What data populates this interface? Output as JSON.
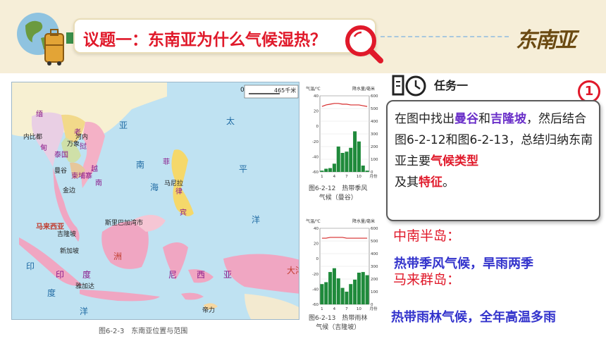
{
  "header": {
    "title": "议题一：东南亚为什么气候湿热？",
    "logo_text": "东南亚"
  },
  "map": {
    "caption": "图6-2-3　东南亚位置与范围",
    "scale": "465千米",
    "scale_zero": "0",
    "countries": {
      "burma": "缅",
      "burma2": "甸",
      "laos": "老",
      "laos2": "挝",
      "thailand": "泰国",
      "vietnam": "越",
      "vietnam2": "南",
      "cambodia": "柬埔寨",
      "philippines": "菲",
      "philippines2": "律",
      "philippines3": "宾",
      "malaysia": "马来西亚",
      "indonesia1": "印",
      "indonesia2": "度",
      "indonesia3": "尼",
      "indonesia4": "西",
      "indonesia5": "亚",
      "brunei": "文莱",
      "eastTimor": "东帝汶"
    },
    "cities": {
      "naypyidaw": "内比都",
      "vientiane": "万象",
      "hanoi": "河内",
      "bangkok": "曼谷",
      "phnompenh": "金边",
      "manila": "马尼拉",
      "kualalumpur": "吉隆坡",
      "singapore": "新加坡",
      "bandar": "斯里巴加湾市",
      "jakarta": "雅加达",
      "dili": "帝力"
    },
    "seas": {
      "asia": "亚",
      "pacific1": "太",
      "pacific2": "平",
      "pacific3": "洋",
      "southsea": "南",
      "sea": "海",
      "indian": "印",
      "indian2": "度",
      "indian3": "洋",
      "zhou": "洲",
      "dayang": "大洋",
      "oceania": "洲"
    }
  },
  "charts": [
    {
      "caption_line1": "图6-2-12　热带季风",
      "caption_line2": "气候（曼谷）",
      "ylabel_left": "气温/℃",
      "ylabel_right": "降水量/毫米",
      "x_ticks": [
        "1",
        "4",
        "7",
        "10",
        "月份"
      ],
      "left_ticks": [
        "40",
        "20",
        "0",
        "-20",
        "-40",
        "-60"
      ],
      "right_ticks": [
        "600",
        "500",
        "400",
        "300",
        "200",
        "100",
        "0"
      ]
    },
    {
      "caption_line1": "图6-2-13　热带雨林",
      "caption_line2": "气候（吉隆坡）",
      "ylabel_left": "气温/℃",
      "ylabel_right": "降水量/毫米",
      "x_ticks": [
        "1",
        "4",
        "7",
        "10",
        "月份"
      ],
      "left_ticks": [
        "40",
        "20",
        "0",
        "-20",
        "-40",
        "-60"
      ],
      "right_ticks": [
        "600",
        "500",
        "400",
        "300",
        "200",
        "100",
        "0"
      ]
    }
  ],
  "chart_data": [
    {
      "type": "bar",
      "categories": [
        "1",
        "2",
        "3",
        "4",
        "5",
        "6",
        "7",
        "8",
        "9",
        "10",
        "11",
        "12"
      ],
      "series": [
        {
          "values": [
            10,
            25,
            30,
            65,
            200,
            150,
            160,
            190,
            320,
            240,
            50,
            10
          ]
        },
        {
          "values": [
            26,
            28,
            29,
            30,
            30,
            29,
            29,
            28,
            28,
            28,
            27,
            26
          ]
        }
      ],
      "ylim_left": [
        -60,
        40
      ],
      "ylim_right": [
        0,
        600
      ]
    },
    {
      "type": "bar",
      "categories": [
        "1",
        "2",
        "3",
        "4",
        "5",
        "6",
        "7",
        "8",
        "9",
        "10",
        "11",
        "12"
      ],
      "series": [
        {
          "values": [
            160,
            175,
            255,
            285,
            205,
            130,
            100,
            160,
            195,
            250,
            255,
            230
          ]
        },
        {
          "values": [
            27,
            27,
            28,
            28,
            28,
            28,
            27,
            27,
            27,
            27,
            27,
            27
          ]
        }
      ],
      "ylim_left": [
        -60,
        40
      ],
      "ylim_right": [
        0,
        600
      ]
    }
  ],
  "task": {
    "label": "任务一",
    "badge": "1",
    "text_a": "在图中找出",
    "bangkok": "曼谷",
    "text_b": "和",
    "kualalumpur": "吉隆坡",
    "text_c": "，然后结合图6-2-12和图6-2-13，总结归纳东南亚主要",
    "climate_type": "气候类型",
    "text_d": "及其",
    "feature": "特征",
    "text_e": "。"
  },
  "answers": {
    "region1": "中南半岛：",
    "answer1": "热带季风气候，旱雨两季",
    "region2": "马来群岛：",
    "answer2": "热带雨林气候，全年高温多雨"
  },
  "colors": {
    "title_red": "#e0192a",
    "answer_blue": "#3333cc",
    "highlight_purple": "#6a2fc9",
    "bar_green": "#1f8a3b",
    "temp_line": "#d62a2a"
  }
}
